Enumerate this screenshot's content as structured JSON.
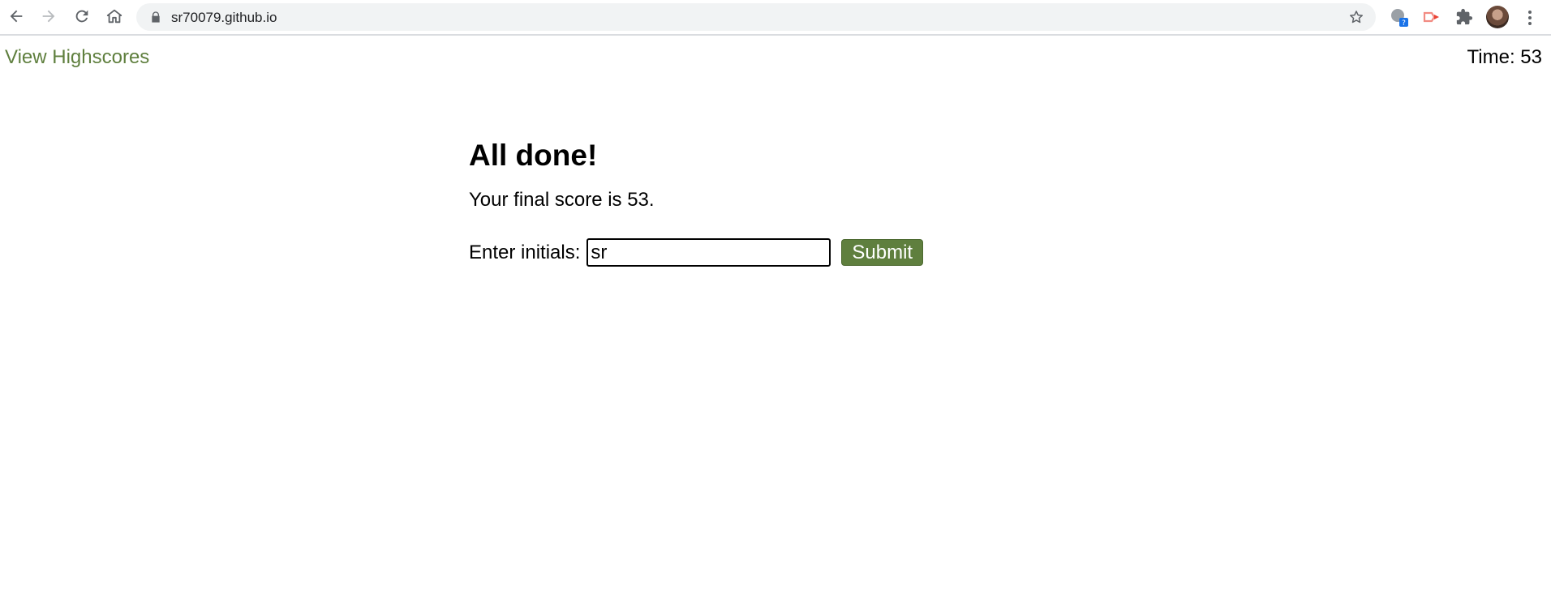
{
  "browser": {
    "url": "sr70079.github.io",
    "icons": {
      "back": "arrow-left-icon",
      "forward": "arrow-right-icon",
      "reload": "reload-icon",
      "home": "home-icon",
      "lock": "lock-icon",
      "bookmark": "star-icon",
      "extensions": [
        "extension-icon-gray",
        "extension-icon-red",
        "puzzle-icon"
      ],
      "profile": "avatar",
      "menu": "more-vert-icon"
    },
    "extension_badge": "?"
  },
  "header": {
    "highscores_label": "View Highscores",
    "time_label": "Time:",
    "time_value": "53"
  },
  "main": {
    "title": "All done!",
    "score_text": "Your final score is 53.",
    "initials_label": "Enter initials:",
    "initials_value": "sr",
    "submit_label": "Submit"
  },
  "colors": {
    "accent": "#5f7f3e",
    "text": "#000000"
  }
}
